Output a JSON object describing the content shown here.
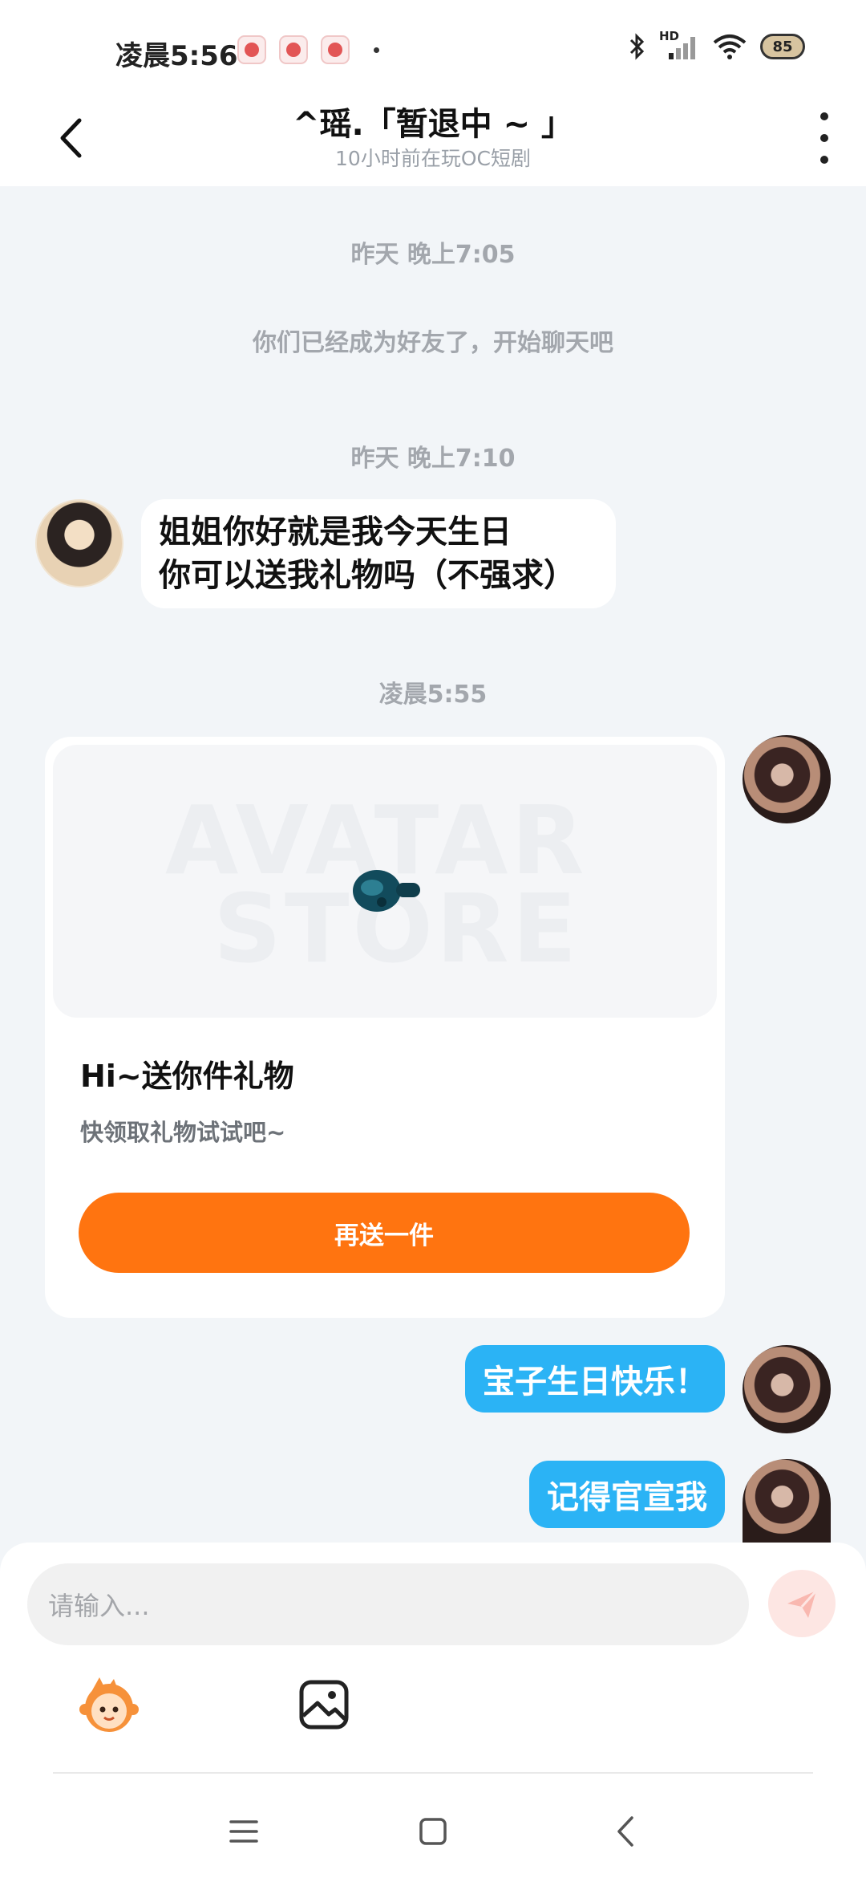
{
  "status_bar": {
    "time": "凌晨5:56",
    "network_label": "HD",
    "battery_level": "85",
    "icons": [
      "app-notification-icon",
      "app-notification-icon",
      "app-notification-icon",
      "bluetooth-icon",
      "signal-icon",
      "wifi-icon",
      "battery-icon"
    ]
  },
  "header": {
    "title": "^瑶.「暂退中 ~ 」",
    "subtitle": "10小时前在玩OC短剧",
    "back_icon": "chevron-left-icon",
    "more_icon": "vertical-dots-icon"
  },
  "messages": {
    "timestamp_1": "昨天 晚上7:05",
    "system_notice": "你们已经成为好友了，开始聊天吧",
    "timestamp_2": "昨天 晚上7:10",
    "incoming_line_1": "姐姐你好就是我今天生日",
    "incoming_line_2": "你可以送我礼物吗（不强求）",
    "timestamp_3": "凌晨5:55",
    "outgoing_1": "宝子生日快乐！",
    "outgoing_2": "记得官宣我"
  },
  "gift_card": {
    "watermark_line_1": "AVATAR",
    "watermark_line_2": "STORE",
    "title": "Hi~送你件礼物",
    "description": "快领取礼物试试吧~",
    "button_label": "再送一件"
  },
  "composer": {
    "placeholder": "请输入...",
    "send_icon": "paper-plane-icon",
    "tools": [
      "mascot-sticker-icon",
      "image-icon"
    ]
  },
  "system_nav": {
    "buttons": [
      "menu-icon",
      "home-icon",
      "back-icon"
    ]
  },
  "colors": {
    "accent_orange": "#ff7410",
    "outgoing_bubble": "#2bb3f5",
    "chat_background": "#f2f5f8"
  }
}
